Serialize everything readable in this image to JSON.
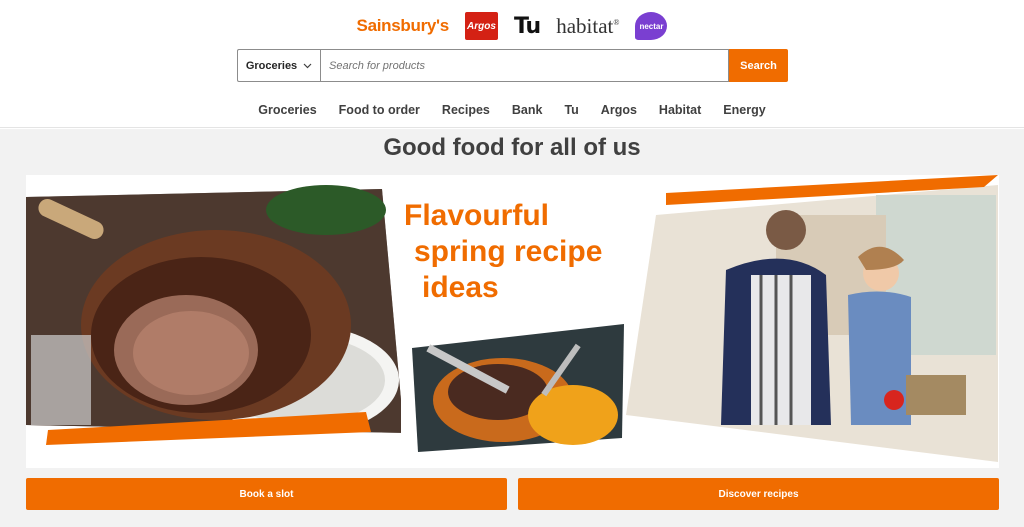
{
  "brands": {
    "sainsburys": "Sainsbury's",
    "argos": "Argos",
    "tu": "Tu",
    "habitat": "habitat",
    "nectar": "nectar"
  },
  "search": {
    "department": "Groceries",
    "placeholder": "Search for products",
    "button_label": "Search"
  },
  "nav": {
    "items": [
      "Groceries",
      "Food to order",
      "Recipes",
      "Bank",
      "Tu",
      "Argos",
      "Habitat",
      "Energy"
    ]
  },
  "main": {
    "title": "Good food for all of us",
    "banner": {
      "headline_lines": [
        "Flavourful",
        "spring recipe",
        "ideas"
      ]
    },
    "buttons": {
      "book_slot": "Book a slot",
      "discover_recipes": "Discover recipes"
    }
  },
  "colors": {
    "accent": "#f06c00",
    "argos_red": "#d42114",
    "nectar_purple": "#7a3fd1",
    "page_bg": "#f2f2f2"
  }
}
